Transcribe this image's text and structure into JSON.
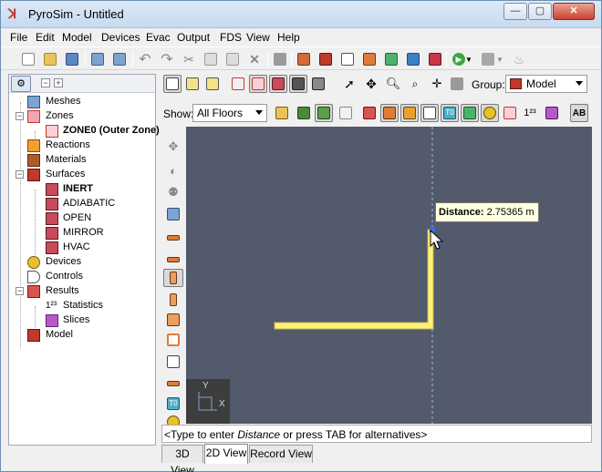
{
  "window": {
    "title": "PyroSim - Untitled",
    "close_symbol": "✕",
    "min_symbol": "—",
    "max_symbol": "▢"
  },
  "menu": [
    "File",
    "Edit",
    "Model",
    "Devices",
    "Evac",
    "Output",
    "FDS",
    "View",
    "Help"
  ],
  "nav": {
    "items": [
      {
        "label": "Meshes",
        "icon": "mesh-icon",
        "bold": false
      },
      {
        "label": "Zones",
        "icon": "zone-icon",
        "bold": false
      },
      {
        "label": "ZONE0 (Outer Zone)",
        "icon": "zone-item-icon",
        "bold": true
      },
      {
        "label": "Reactions",
        "icon": "reaction-icon",
        "bold": false
      },
      {
        "label": "Materials",
        "icon": "material-icon",
        "bold": false
      },
      {
        "label": "Surfaces",
        "icon": "surface-icon",
        "bold": false
      },
      {
        "label": "INERT",
        "icon": "surface-item-icon",
        "bold": true
      },
      {
        "label": "ADIABATIC",
        "icon": "surface-item-icon",
        "bold": false
      },
      {
        "label": "OPEN",
        "icon": "surface-item-icon",
        "bold": false
      },
      {
        "label": "MIRROR",
        "icon": "surface-item-icon",
        "bold": false
      },
      {
        "label": "HVAC",
        "icon": "surface-item-icon",
        "bold": false
      },
      {
        "label": "Devices",
        "icon": "device-icon",
        "bold": false
      },
      {
        "label": "Controls",
        "icon": "control-icon",
        "bold": false
      },
      {
        "label": "Results",
        "icon": "results-icon",
        "bold": false
      },
      {
        "label": "Statistics",
        "icon": "statistics-icon",
        "bold": false
      },
      {
        "label": "Slices",
        "icon": "slices-icon",
        "bold": false
      },
      {
        "label": "Model",
        "icon": "model-icon",
        "bold": false
      }
    ]
  },
  "view_toolbar": {
    "show_label": "Show:",
    "floor_value": "All Floors",
    "group_label": "Group:",
    "group_value": "Model"
  },
  "tooltip": {
    "key": "Distance:",
    "value": "2.75365 m"
  },
  "command_line": {
    "prefix": "<Type to enter ",
    "emph": "Distance",
    "suffix": " or press TAB for alternatives>"
  },
  "axis": {
    "y": "Y",
    "x": "X"
  },
  "tabs": [
    "3D View",
    "2D View",
    "Record View"
  ],
  "active_tab": "2D View",
  "colors": {
    "canvas": "#525a6c",
    "duct": "#fff27a",
    "accent": "#3f6ad8"
  }
}
